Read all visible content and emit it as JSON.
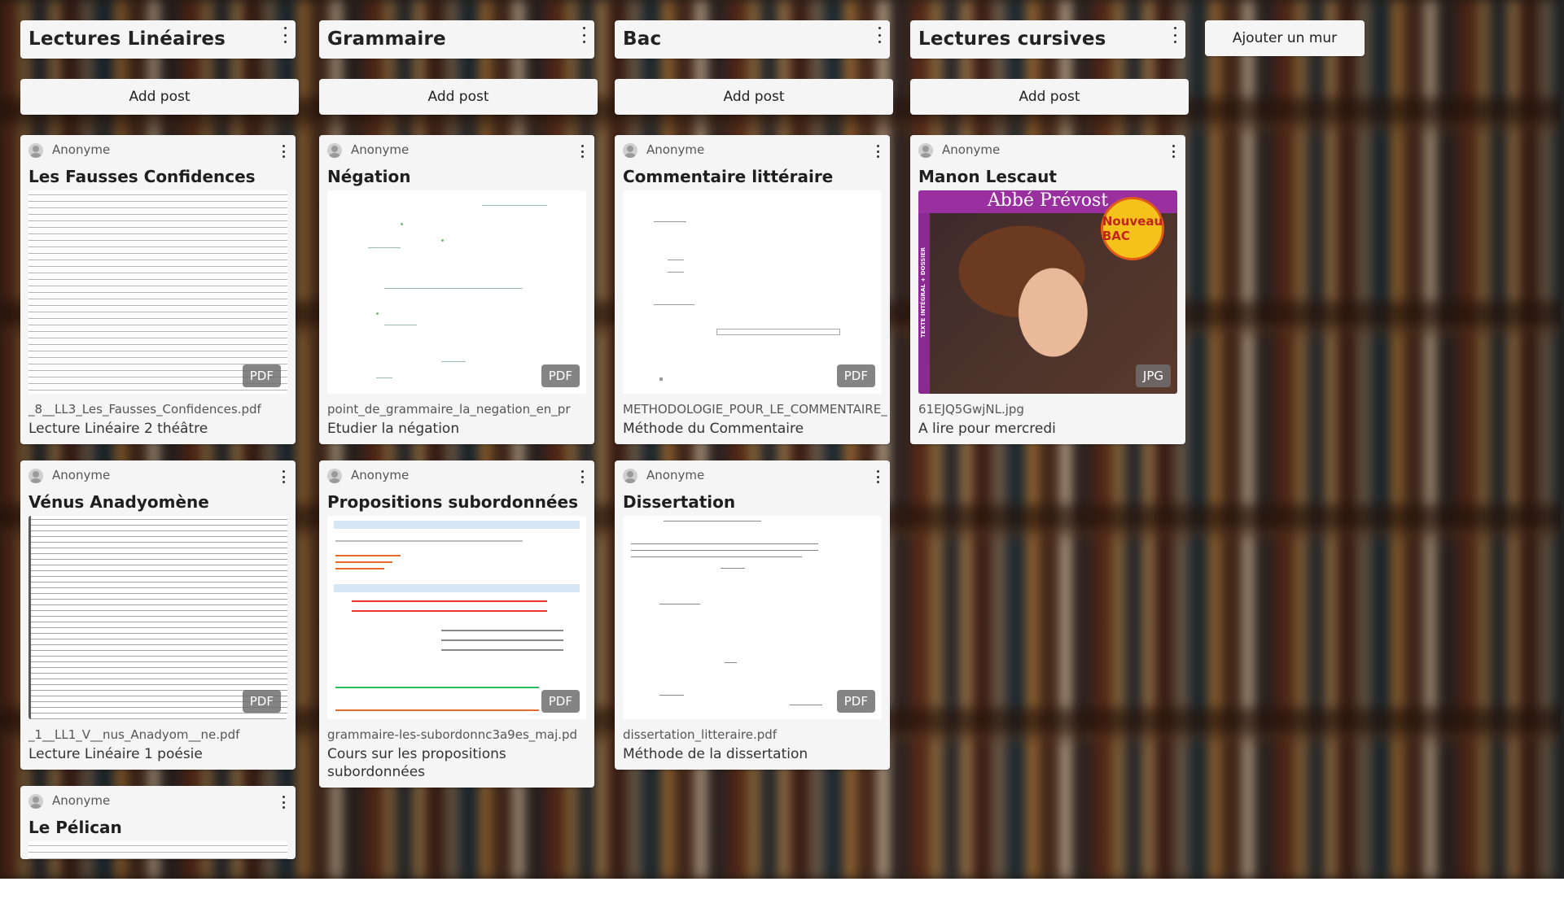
{
  "columns": [
    {
      "title": "Lectures Linéaires",
      "add_post_label": "Add post",
      "posts": [
        {
          "author": "Anonyme",
          "title": "Les Fausses Confidences",
          "file_type": "PDF",
          "filename": "_8__LL3_Les_Fausses_Confidences.pdf",
          "description": "Lecture Linéaire 2 théâtre"
        },
        {
          "author": "Anonyme",
          "title": "Vénus Anadyomène",
          "file_type": "PDF",
          "filename": "_1__LL1_V__nus_Anadyom__ne.pdf",
          "description": "Lecture Linéaire 1 poésie"
        },
        {
          "author": "Anonyme",
          "title": "Le Pélican"
        }
      ]
    },
    {
      "title": "Grammaire",
      "add_post_label": "Add post",
      "posts": [
        {
          "author": "Anonyme",
          "title": "Négation",
          "file_type": "PDF",
          "filename": "point_de_grammaire_la_negation_en_pr",
          "description": "Etudier la négation"
        },
        {
          "author": "Anonyme",
          "title": "Propositions subordonnées",
          "file_type": "PDF",
          "filename": "grammaire-les-subordonnc3a9es_maj.pd",
          "description": "Cours sur les propositions subordonnées"
        }
      ]
    },
    {
      "title": "Bac",
      "add_post_label": "Add post",
      "posts": [
        {
          "author": "Anonyme",
          "title": "Commentaire littéraire",
          "file_type": "PDF",
          "filename": "METHODOLOGIE_POUR_LE_COMMENTAIRE_",
          "description": "Méthode du Commentaire"
        },
        {
          "author": "Anonyme",
          "title": "Dissertation",
          "file_type": "PDF",
          "filename": "dissertation_litteraire.pdf",
          "description": "Méthode de la dissertation"
        }
      ]
    },
    {
      "title": "Lectures cursives",
      "add_post_label": "Add post",
      "posts": [
        {
          "author": "Anonyme",
          "title": "Manon Lescaut",
          "file_type": "JPG",
          "filename": "61EJQ5GwjNL.jpg",
          "description": "A lire pour mercredi",
          "cover": {
            "title": "Abbé Prévost",
            "seal": "Nouveau BAC",
            "side": "TEXTE INTÉGRAL + DOSSIER"
          }
        }
      ]
    }
  ],
  "add_wall_label": "Ajouter un mur",
  "icons": {
    "menu": "kebab-menu-icon",
    "avatar": "user-avatar-icon"
  }
}
